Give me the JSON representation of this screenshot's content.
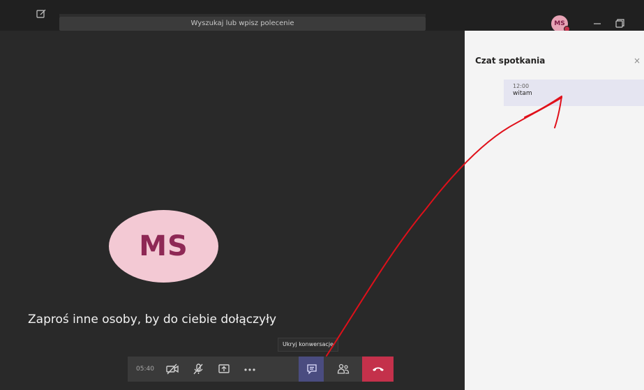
{
  "titlebar": {
    "search_placeholder": "Wyszukaj lub wpisz polecenie",
    "user_initials": "MS",
    "icons": [
      "compose-icon",
      "minimize-icon",
      "restore-icon"
    ]
  },
  "stage": {
    "participant_initials": "MS",
    "invite_text": "Zaproś inne osoby, by do ciebie dołączyły",
    "tooltip": "Ukryj konwersację"
  },
  "controls": {
    "timer": "05:40",
    "buttons": [
      "camera-off-icon",
      "mic-off-icon",
      "share-screen-icon",
      "more-icon",
      "chat-icon",
      "participants-icon",
      "hang-up-icon"
    ],
    "active_button": "chat-icon"
  },
  "chat": {
    "title": "Czat spotkania",
    "close": "×",
    "messages": [
      {
        "time": "12:00",
        "text": "witam"
      }
    ]
  },
  "colors": {
    "stage_background": "#292929",
    "titlebar_background": "#202020",
    "avatar_background": "#f3c9d4",
    "avatar_text": "#8e2855",
    "hangup": "#c4314b",
    "active_control": "#4a4c80",
    "annotation_arrow": "#e0101a"
  }
}
